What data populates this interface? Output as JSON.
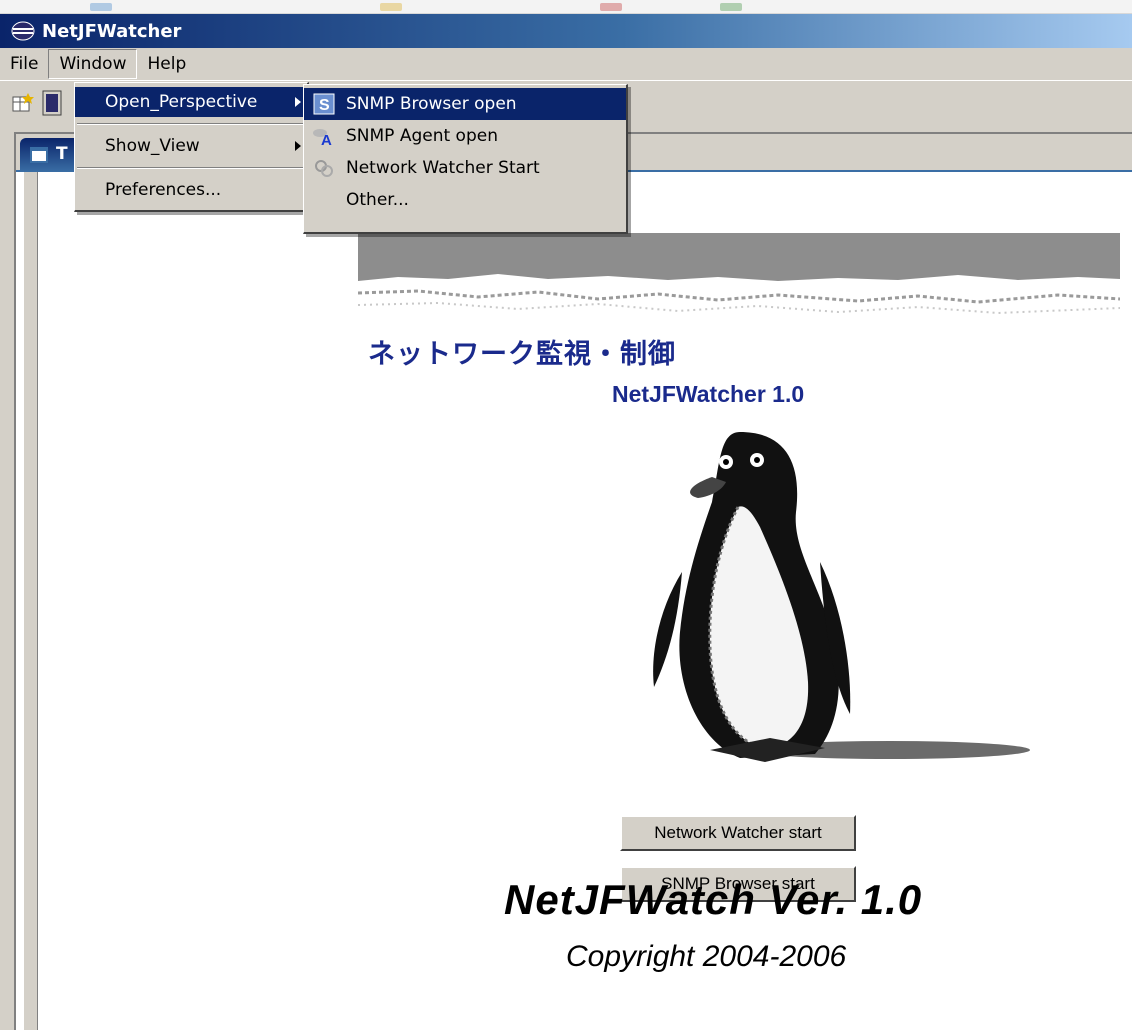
{
  "window": {
    "title": "NetJFWatcher",
    "icon": "eclipse-icon"
  },
  "menubar": {
    "items": [
      {
        "label": "File"
      },
      {
        "label": "Window"
      },
      {
        "label": "Help"
      }
    ]
  },
  "window_menu": {
    "items": [
      {
        "label": "Open_Perspective",
        "has_submenu": true
      },
      {
        "label": "Show_View",
        "has_submenu": true
      },
      {
        "label": "Preferences..."
      }
    ]
  },
  "perspective_submenu": {
    "items": [
      {
        "label": "SNMP Browser open",
        "icon": "snmp-browser-icon"
      },
      {
        "label": "SNMP Agent open",
        "icon": "snmp-agent-icon"
      },
      {
        "label": "Network Watcher Start",
        "icon": "network-watcher-icon"
      },
      {
        "label": "Other..."
      }
    ]
  },
  "view_tab": {
    "label": "T"
  },
  "content": {
    "jp_title": "ネットワーク監視・制御",
    "version_title": "NetJFWatcher 1.0",
    "buttons": {
      "network_watcher": "Network Watcher start",
      "snmp_browser": "SNMP Browser start"
    },
    "big_version": "NetJFWatch Ver. 1.0",
    "copyright": "Copyright 2004-2006"
  },
  "colors": {
    "title_gradient_start": "#0a246a",
    "title_gradient_end": "#a6caf0",
    "menu_highlight": "#0a246a",
    "heading_text": "#1a2a8c",
    "chrome": "#d4d0c8"
  }
}
